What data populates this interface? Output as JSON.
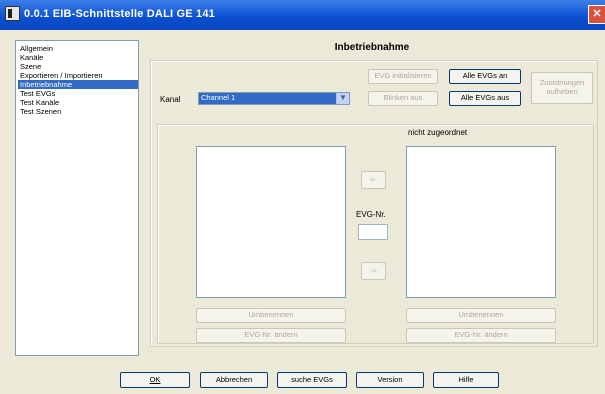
{
  "window": {
    "title": "0.0.1  EIB-Schnittstelle DALI GE 141",
    "close_glyph": "✕"
  },
  "nav": {
    "items": [
      {
        "label": "Allgemein",
        "selected": false
      },
      {
        "label": "Kanäle",
        "selected": false
      },
      {
        "label": "Szene",
        "selected": false
      },
      {
        "label": "Exportieren / Importieren",
        "selected": false
      },
      {
        "label": "Inbetriebnahme",
        "selected": true
      },
      {
        "label": "Test EVGs",
        "selected": false
      },
      {
        "label": "Test Kanäle",
        "selected": false
      },
      {
        "label": "Test Szenen",
        "selected": false
      }
    ]
  },
  "main": {
    "title": "Inbetriebnahme",
    "kanal_label": "Kanal",
    "kanal_value": "Channel 1",
    "evg_initialisieren": "EVG initialisieren",
    "blinken_aus": "Blinken aus",
    "alle_evgs_an": "Alle EVGs an",
    "alle_evgs_aus": "Alle EVGs aus",
    "zuordnungen_aufheben": "Zuordnungen aufheben",
    "nicht_zugeordnet": "nicht zugeordnet",
    "move_left": "<-",
    "move_right": "->",
    "evg_nr_label": "EVG-Nr.",
    "evg_nr_value": "",
    "left_umbenennen": "Umbenennen",
    "left_evg_nr_aendern": "EVG-Nr. ändern",
    "right_umbenennen": "Umbenennen",
    "right_evg_nr_aendern": "EVG-Nr. ändern"
  },
  "footer": {
    "ok": "OK",
    "abbrechen": "Abbrechen",
    "suche_evgs": "suche EVGs",
    "version": "Version",
    "hilfe": "Hilfe"
  },
  "colors": {
    "titlebar": "#0a4fd0",
    "selection": "#316ac5",
    "dialog_bg": "#ece9d8"
  }
}
